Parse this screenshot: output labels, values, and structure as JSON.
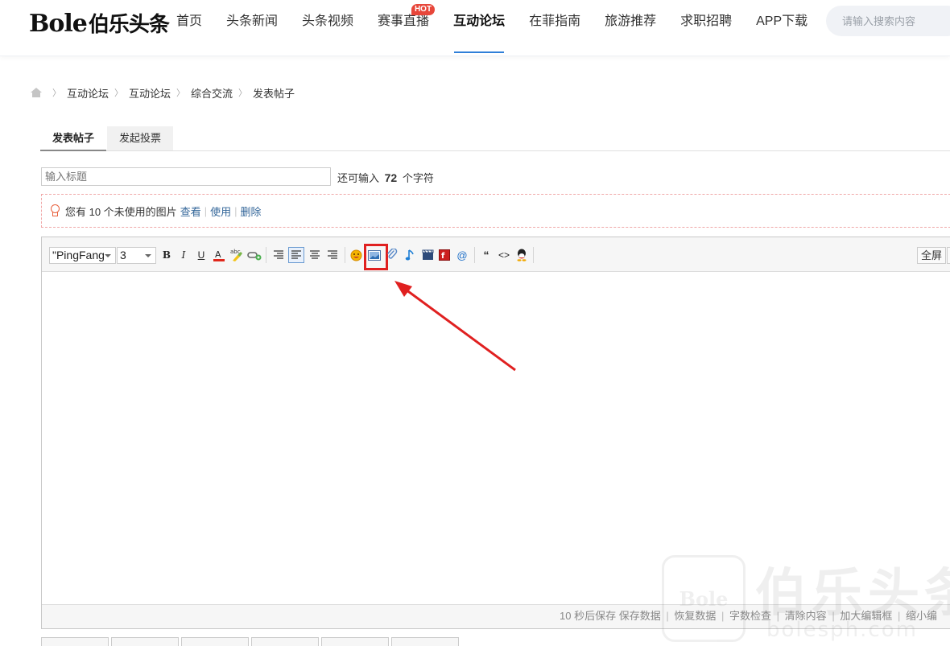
{
  "header": {
    "logo_en": "Bole",
    "logo_cn": "伯乐头条",
    "nav": [
      "首页",
      "头条新闻",
      "头条视频",
      "赛事直播",
      "互动论坛",
      "在菲指南",
      "旅游推荐",
      "求职招聘",
      "APP下载"
    ],
    "active_nav": "互动论坛",
    "hot_badge": "HOT",
    "search_placeholder": "请输入搜索内容"
  },
  "breadcrumb": {
    "items": [
      "互动论坛",
      "互动论坛",
      "综合交流",
      "发表帖子"
    ]
  },
  "tabs": {
    "post": "发表帖子",
    "poll": "发起投票"
  },
  "title_field": {
    "placeholder": "输入标题",
    "remaining_prefix": "还可输入",
    "remaining_count": "72",
    "remaining_suffix": "个字符"
  },
  "notice": {
    "text": "您有 10 个未使用的图片",
    "view": "查看",
    "use": "使用",
    "delete": "删除"
  },
  "toolbar": {
    "font": "\"PingFang",
    "size": "3",
    "fullscreen": "全屏"
  },
  "editor_footer": {
    "autosave": "10 秒后保存",
    "save": "保存数据",
    "restore": "恢复数据",
    "wordcount": "字数检查",
    "clear": "清除内容",
    "enlarge": "加大编辑框",
    "shrink": "缩小编"
  },
  "watermark": {
    "box": "Bole",
    "text": "伯乐头条",
    "url": "bolesph.com"
  },
  "colors": {
    "accent": "#2f7fd8",
    "hot": "#e7463a",
    "highlight": "#e02020",
    "link": "#336699"
  }
}
